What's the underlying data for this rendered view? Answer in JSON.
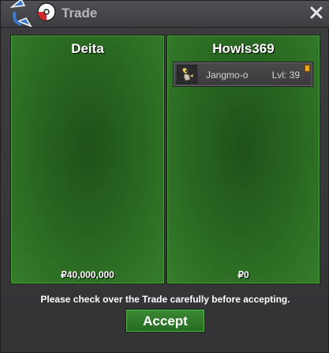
{
  "window": {
    "title": "Trade",
    "close_icon": "close-icon"
  },
  "left_panel": {
    "player_name": "Deita",
    "money": "₽40,000,000"
  },
  "right_panel": {
    "player_name": "Howls369",
    "money": "₽0",
    "items": [
      {
        "icon": "pokemon-sprite-icon",
        "name": "Jangmo-o",
        "level": "Lvl: 39"
      }
    ]
  },
  "footer": {
    "notice": "Please check over the Trade carefully before accepting.",
    "accept_label": "Accept"
  },
  "colors": {
    "panel_green": "#2a6922",
    "button_green": "#2e7a2a",
    "window_gray": "#3a3a3c"
  }
}
